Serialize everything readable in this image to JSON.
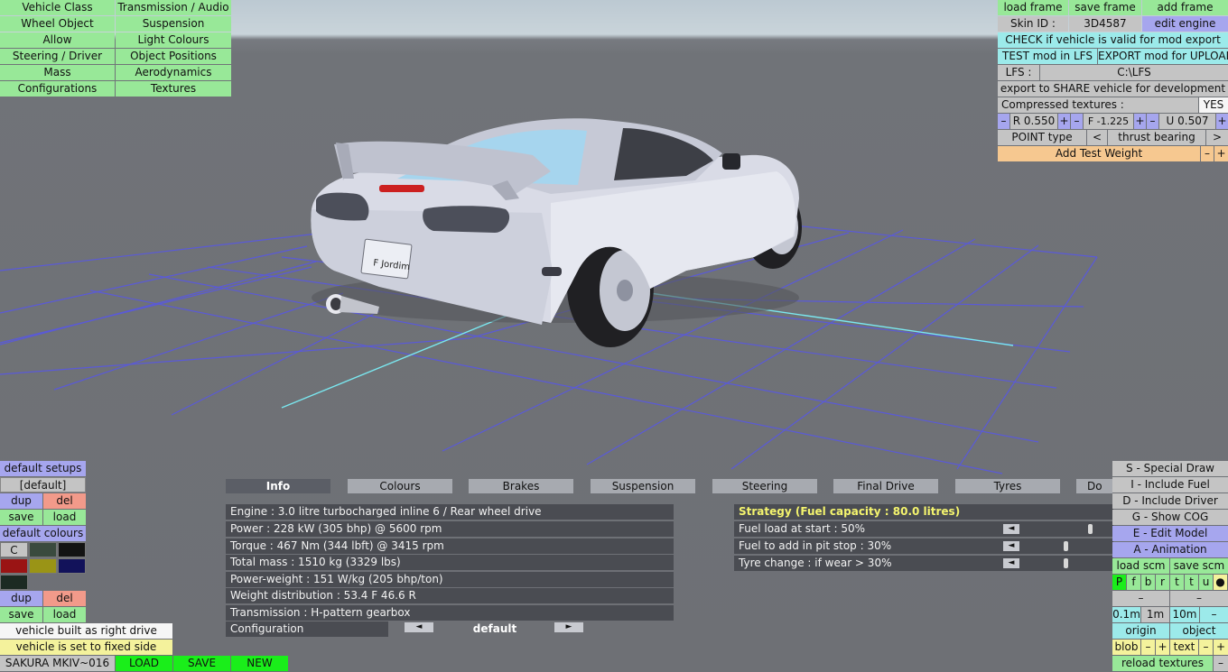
{
  "top_left_menu": [
    [
      "Vehicle Class",
      "Transmission / Audio"
    ],
    [
      "Wheel Object",
      "Suspension"
    ],
    [
      "Allow",
      "Light Colours"
    ],
    [
      "Steering / Driver",
      "Object Positions"
    ],
    [
      "Mass",
      "Aerodynamics"
    ],
    [
      "Configurations",
      "Textures"
    ]
  ],
  "top_right": {
    "load_frame": "load frame",
    "save_frame": "save frame",
    "add_frame": "add frame",
    "skin_label": "Skin ID :",
    "skin_value": "3D4587",
    "edit_engine": "edit engine",
    "check_valid": "CHECK if vehicle is valid for mod export",
    "test_mod": "TEST mod in LFS",
    "export_mod": "EXPORT mod for UPLOAD",
    "lfs_label": "LFS :",
    "lfs_path": "C:\\LFS",
    "export_share": "export to SHARE vehicle for development",
    "compressed_label": "Compressed textures :",
    "compressed_value": "YES",
    "minus": "–",
    "plus": "+",
    "r_value": "R 0.550",
    "f_value": "F -1.225",
    "u_value": "U 0.507",
    "point_type": "POINT type",
    "prev": "<",
    "next": ">",
    "thrust_bearing": "thrust bearing",
    "add_test_weight": "Add Test Weight"
  },
  "car": {
    "plate_text": "F Jordim"
  },
  "tabs": [
    "Info",
    "Colours",
    "Brakes",
    "Suspension",
    "Steering",
    "Final Drive",
    "Tyres",
    "Do"
  ],
  "info_rows": [
    "Engine : 3.0 litre turbocharged inline 6 / Rear wheel drive",
    "Power : 228 kW (305 bhp) @ 5600 rpm",
    "Torque : 467 Nm (344 lbft) @ 3415 rpm",
    "Total mass : 1510 kg (3329 lbs)",
    "Power-weight : 151 W/kg (205 bhp/ton)",
    "Weight distribution : 53.4 F  46.6 R",
    "Transmission : H-pattern gearbox"
  ],
  "configuration": {
    "label": "Configuration",
    "value": "default",
    "left_arrow": "◄",
    "right_arrow": "►"
  },
  "strategy": {
    "title": "Strategy (Fuel capacity : 80.0 litres)",
    "rows": [
      {
        "label": "Fuel load at start : 50%",
        "level": 0.5
      },
      {
        "label": "Fuel to add in pit stop : 30%",
        "level": 0.3
      },
      {
        "label": "Tyre change : if wear > 30%",
        "level": 0.3
      }
    ],
    "arrow": "◄"
  },
  "bottom_left": {
    "default_setups": "default setups",
    "default_setup_name": "[default]",
    "dup": "dup",
    "del": "del",
    "save": "save",
    "load": "load",
    "default_colours": "default colours",
    "c_label": "C",
    "built_right_drive": "vehicle built as right drive",
    "fixed_side": "vehicle is set to fixed side",
    "vehicle_name": "SAKURA MKIV~016",
    "load_btn": "LOAD",
    "save_btn": "SAVE",
    "new_btn": "NEW",
    "swatches": [
      "#3a4a3e",
      "#131313",
      "#9a1414",
      "#9a9416",
      "#12125a",
      "#1c2a22"
    ]
  },
  "bottom_right": {
    "special_draw": "S - Special Draw",
    "include_fuel": "I - Include Fuel",
    "include_driver": "D - Include Driver",
    "show_cog": "G - Show COG",
    "edit_model": "E - Edit Model",
    "animation": "A - Animation",
    "load_scm": "load scm",
    "save_scm": "save scm",
    "letters": [
      "P",
      "f",
      "b",
      "r",
      "t",
      "t",
      "u",
      "●"
    ],
    "dash": "–",
    "step_01": "0.1m",
    "step_1": "1m",
    "step_10": "10m",
    "minus": "–",
    "origin": "origin",
    "object": "object",
    "blob": "blob",
    "text": "text",
    "plus": "+",
    "reload_textures": "reload textures"
  }
}
